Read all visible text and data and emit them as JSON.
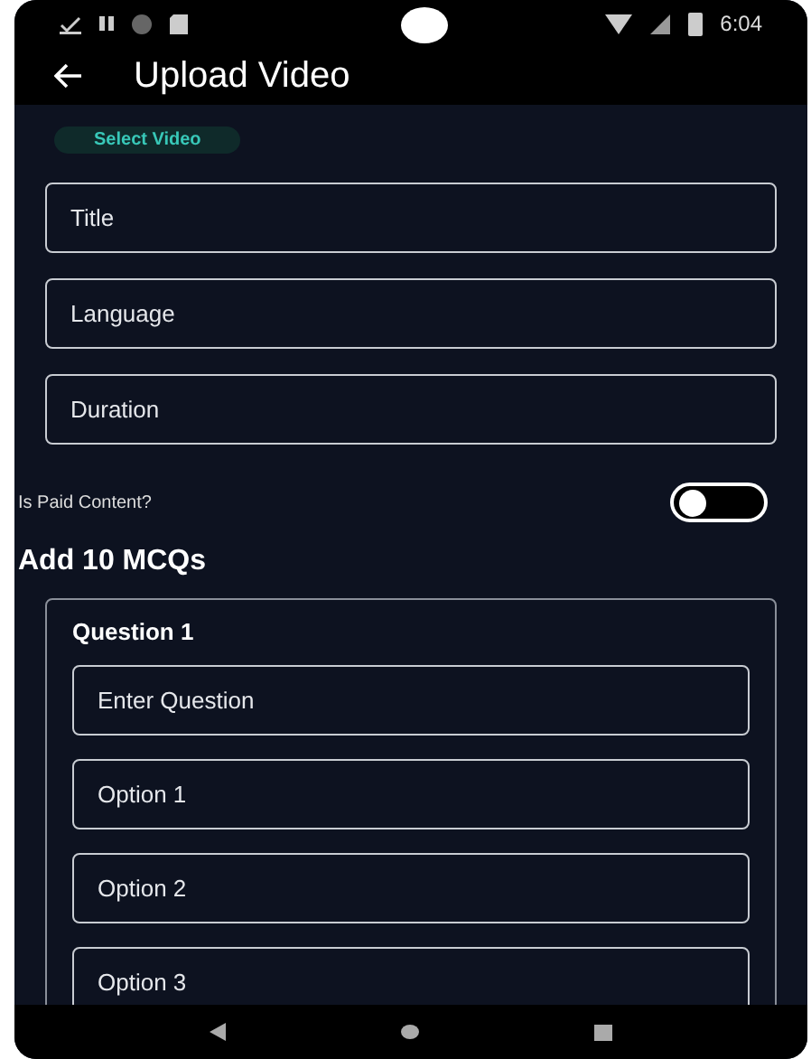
{
  "status_bar": {
    "time": "6:04"
  },
  "app_bar": {
    "title": "Upload Video"
  },
  "select_video_button": "Select Video",
  "fields": [
    {
      "placeholder": "Title"
    },
    {
      "placeholder": "Language"
    },
    {
      "placeholder": "Duration"
    }
  ],
  "paid_toggle": {
    "label": "Is Paid Content?",
    "on": false
  },
  "mcq_heading": "Add 10 MCQs",
  "question_card": {
    "title": "Question 1",
    "fields": [
      {
        "placeholder": "Enter Question"
      },
      {
        "placeholder": "Option 1"
      },
      {
        "placeholder": "Option 2"
      },
      {
        "placeholder": "Option 3"
      }
    ]
  }
}
